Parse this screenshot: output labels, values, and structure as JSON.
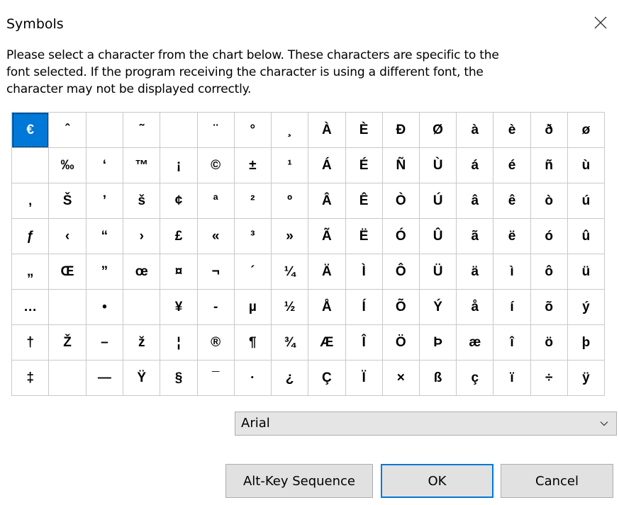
{
  "window": {
    "title": "Symbols"
  },
  "instructions": [
    "Please select a character from the chart below.  These characters are specific to the",
    "font selected.  If the program receiving the character is using a different font, the",
    "character may not be displayed correctly."
  ],
  "grid": {
    "selected": [
      0,
      0
    ],
    "rows": [
      [
        "€",
        "ˆ",
        "",
        "˜",
        "",
        "¨",
        "°",
        "¸",
        "À",
        "È",
        "Ð",
        "Ø",
        "à",
        "è",
        "ð",
        "ø"
      ],
      [
        "",
        "‰",
        "‘",
        "™",
        "¡",
        "©",
        "±",
        "¹",
        "Á",
        "É",
        "Ñ",
        "Ù",
        "á",
        "é",
        "ñ",
        "ù"
      ],
      [
        "‚",
        "Š",
        "’",
        "š",
        "¢",
        "ª",
        "²",
        "º",
        "Â",
        "Ê",
        "Ò",
        "Ú",
        "â",
        "ê",
        "ò",
        "ú"
      ],
      [
        "ƒ",
        "‹",
        "“",
        "›",
        "£",
        "«",
        "³",
        "»",
        "Ã",
        "Ë",
        "Ó",
        "Û",
        "ã",
        "ë",
        "ó",
        "û"
      ],
      [
        "„",
        "Œ",
        "”",
        "œ",
        "¤",
        "¬",
        "´",
        "¼",
        "Ä",
        "Ì",
        "Ô",
        "Ü",
        "ä",
        "ì",
        "ô",
        "ü"
      ],
      [
        "…",
        "",
        "•",
        "",
        "¥",
        "-",
        "µ",
        "½",
        "Å",
        "Í",
        "Õ",
        "Ý",
        "å",
        "í",
        "õ",
        "ý"
      ],
      [
        "†",
        "Ž",
        "–",
        "ž",
        "¦",
        "®",
        "¶",
        "¾",
        "Æ",
        "Î",
        "Ö",
        "Þ",
        "æ",
        "î",
        "ö",
        "þ"
      ],
      [
        "‡",
        "",
        "—",
        "Ÿ",
        "§",
        "¯",
        "·",
        "¿",
        "Ç",
        "Ï",
        "×",
        "ß",
        "ç",
        "ï",
        "÷",
        "ÿ"
      ]
    ]
  },
  "font_select": {
    "value": "Arial",
    "icon": "chevron-down-icon"
  },
  "buttons": {
    "alt_key": "Alt-Key Sequence",
    "ok": "OK",
    "cancel": "Cancel"
  },
  "colors": {
    "selection": "#0078d7",
    "button_face": "#e1e1e1"
  }
}
